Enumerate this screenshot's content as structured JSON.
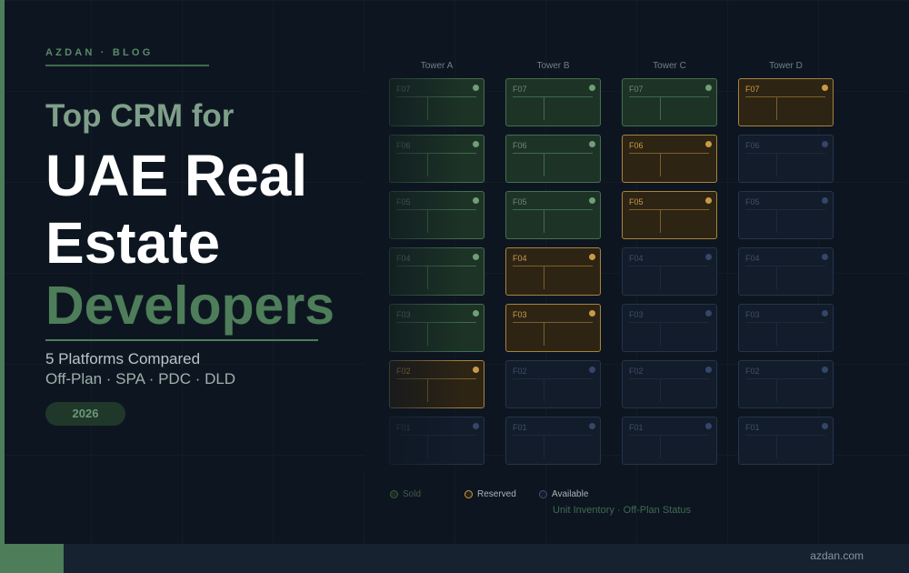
{
  "brand": "AZDAN · BLOG",
  "headline": {
    "line1": "Top CRM for",
    "line2": "UAE Real",
    "line3": "Estate",
    "line4": "Developers"
  },
  "subtitle": {
    "line1": "5 Platforms Compared",
    "line2": "Off-Plan · SPA · PDC · DLD"
  },
  "year_badge": "2026",
  "colors": {
    "accent_green": "#4e7d5a",
    "sold": "#6f9e77",
    "reserved": "#c99a45",
    "available": "#34466a",
    "background": "#0d1620"
  },
  "inventory": {
    "towers": [
      {
        "name": "Tower A",
        "units": [
          {
            "label": "F07",
            "status": "sold"
          },
          {
            "label": "F06",
            "status": "sold"
          },
          {
            "label": "F05",
            "status": "sold"
          },
          {
            "label": "F04",
            "status": "sold"
          },
          {
            "label": "F03",
            "status": "sold"
          },
          {
            "label": "F02",
            "status": "reserved"
          },
          {
            "label": "F01",
            "status": "available"
          }
        ]
      },
      {
        "name": "Tower B",
        "units": [
          {
            "label": "F07",
            "status": "sold"
          },
          {
            "label": "F06",
            "status": "sold"
          },
          {
            "label": "F05",
            "status": "sold"
          },
          {
            "label": "F04",
            "status": "reserved"
          },
          {
            "label": "F03",
            "status": "reserved"
          },
          {
            "label": "F02",
            "status": "available"
          },
          {
            "label": "F01",
            "status": "available"
          }
        ]
      },
      {
        "name": "Tower C",
        "units": [
          {
            "label": "F07",
            "status": "sold"
          },
          {
            "label": "F06",
            "status": "reserved"
          },
          {
            "label": "F05",
            "status": "reserved"
          },
          {
            "label": "F04",
            "status": "available"
          },
          {
            "label": "F03",
            "status": "available"
          },
          {
            "label": "F02",
            "status": "available"
          },
          {
            "label": "F01",
            "status": "available"
          }
        ]
      },
      {
        "name": "Tower D",
        "units": [
          {
            "label": "F07",
            "status": "reserved"
          },
          {
            "label": "F06",
            "status": "available"
          },
          {
            "label": "F05",
            "status": "available"
          },
          {
            "label": "F04",
            "status": "available"
          },
          {
            "label": "F03",
            "status": "available"
          },
          {
            "label": "F02",
            "status": "available"
          },
          {
            "label": "F01",
            "status": "available"
          }
        ]
      }
    ],
    "legend": {
      "sold": "Sold",
      "reserved": "Reserved",
      "available": "Available"
    },
    "caption": "Unit Inventory · Off-Plan Status"
  },
  "footer": {
    "url": "azdan.com"
  }
}
